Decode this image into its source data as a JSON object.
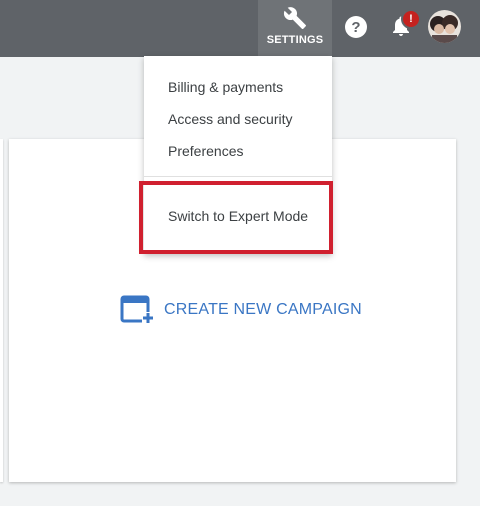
{
  "topbar": {
    "settings_label": "SETTINGS",
    "help_symbol": "?",
    "notification_badge": "!",
    "icons": [
      "wrench-icon",
      "help-icon",
      "bell-icon",
      "avatar"
    ]
  },
  "settings_menu": {
    "items": [
      {
        "label": "Billing & payments"
      },
      {
        "label": "Access and security"
      },
      {
        "label": "Preferences"
      },
      {
        "label": "Switch to Expert Mode"
      }
    ]
  },
  "main": {
    "create_campaign_label": "CREATE NEW CAMPAIGN"
  },
  "colors": {
    "topbar": "#5f6368",
    "accent_blue": "#3a76c4",
    "highlight_red": "#d0202f",
    "badge_red": "#c5221f"
  }
}
